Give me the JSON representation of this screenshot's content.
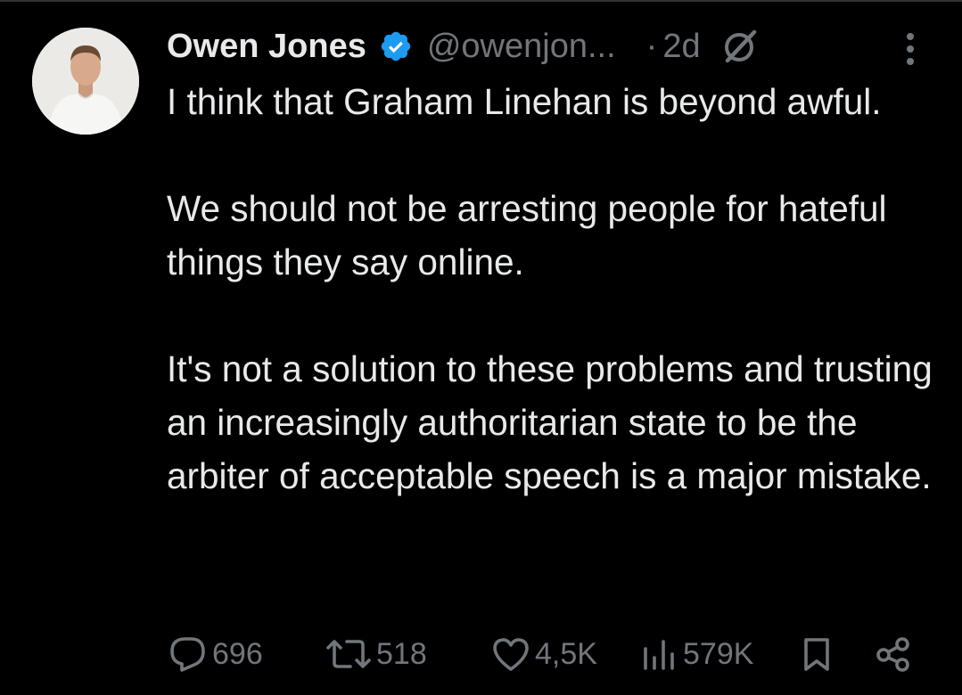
{
  "author": {
    "name": "Owen Jones",
    "handle": "@owenjon...",
    "separator": "·",
    "time": "2d",
    "verified_color": "#1d9bf0"
  },
  "tweet": {
    "paragraphs": [
      "I think that Graham Linehan is beyond awful.",
      "We should not be arresting people for hateful things they say online.",
      "It's not a solution to these problems and trusting an increasingly authoritarian state to be the arbiter of acceptable speech is a major mistake."
    ]
  },
  "actions": {
    "replies": "696",
    "reposts": "518",
    "likes": "4,5K",
    "views": "579K"
  },
  "icons": {
    "avatar": "avatar",
    "verified": "verified-badge-icon",
    "grok": "grok-icon",
    "more": "more-icon",
    "reply": "reply-icon",
    "repost": "repost-icon",
    "like": "like-icon",
    "views": "views-icon",
    "bookmark": "bookmark-icon",
    "share": "share-icon"
  },
  "colors": {
    "background": "#000000",
    "text": "#e7e9ea",
    "muted": "#71767b",
    "accent": "#1d9bf0"
  }
}
